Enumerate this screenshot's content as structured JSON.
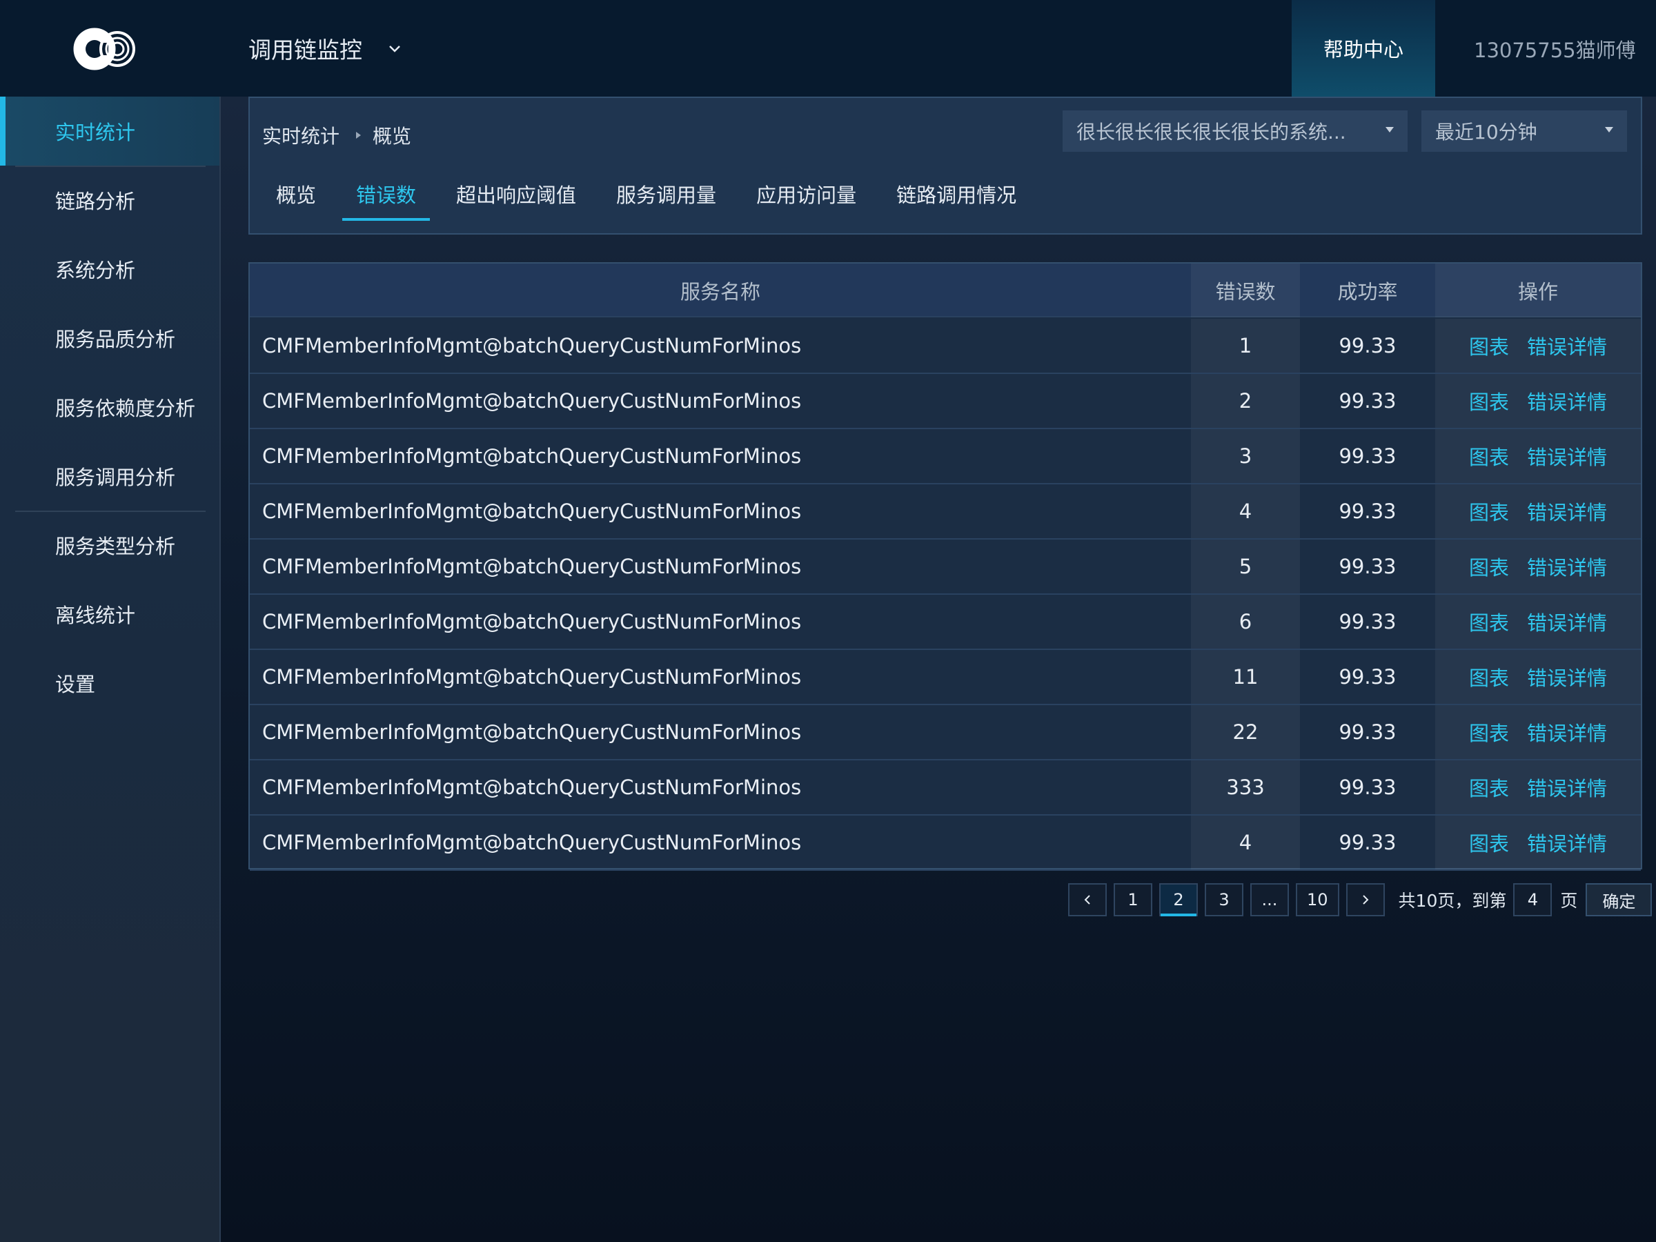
{
  "header": {
    "logo_icon": "swirl-logo-icon",
    "app_title": "调用链监控",
    "help": "帮助中心",
    "user": "13075755猫师傅"
  },
  "sidebar": {
    "items": [
      {
        "label": "实时统计",
        "active": true
      },
      {
        "label": "链路分析"
      },
      {
        "label": "系统分析"
      },
      {
        "label": "服务品质分析"
      },
      {
        "label": "服务依赖度分析"
      },
      {
        "label": "服务调用分析"
      },
      {
        "label": "服务类型分析"
      },
      {
        "label": "离线统计"
      },
      {
        "label": "设置"
      }
    ]
  },
  "breadcrumb": {
    "root": "实时统计",
    "current": "概览"
  },
  "filters": {
    "system": "很长很长很长很长很长的系统...",
    "time_range": "最近10分钟"
  },
  "tabs": [
    {
      "label": "概览"
    },
    {
      "label": "错误数",
      "active": true
    },
    {
      "label": "超出响应阈值"
    },
    {
      "label": "服务调用量"
    },
    {
      "label": "应用访问量"
    },
    {
      "label": "链路调用情况"
    }
  ],
  "table": {
    "columns": [
      "服务名称",
      "错误数",
      "成功率",
      "操作"
    ],
    "actions": [
      "图表",
      "错误详情"
    ],
    "rows": [
      {
        "name": "CMFMemberInfoMgmt@batchQueryCustNumForMinos",
        "errors": "1",
        "rate": "99.33"
      },
      {
        "name": "CMFMemberInfoMgmt@batchQueryCustNumForMinos",
        "errors": "2",
        "rate": "99.33"
      },
      {
        "name": "CMFMemberInfoMgmt@batchQueryCustNumForMinos",
        "errors": "3",
        "rate": "99.33"
      },
      {
        "name": "CMFMemberInfoMgmt@batchQueryCustNumForMinos",
        "errors": "4",
        "rate": "99.33"
      },
      {
        "name": "CMFMemberInfoMgmt@batchQueryCustNumForMinos",
        "errors": "5",
        "rate": "99.33"
      },
      {
        "name": "CMFMemberInfoMgmt@batchQueryCustNumForMinos",
        "errors": "6",
        "rate": "99.33"
      },
      {
        "name": "CMFMemberInfoMgmt@batchQueryCustNumForMinos",
        "errors": "11",
        "rate": "99.33"
      },
      {
        "name": "CMFMemberInfoMgmt@batchQueryCustNumForMinos",
        "errors": "22",
        "rate": "99.33"
      },
      {
        "name": "CMFMemberInfoMgmt@batchQueryCustNumForMinos",
        "errors": "333",
        "rate": "99.33"
      },
      {
        "name": "CMFMemberInfoMgmt@batchQueryCustNumForMinos",
        "errors": "4",
        "rate": "99.33"
      }
    ]
  },
  "pagination": {
    "pages": [
      "1",
      "2",
      "3",
      "...",
      "10"
    ],
    "active_page": "2",
    "total_text": "共10页，到第",
    "goto_value": "4",
    "page_suffix": "页",
    "confirm": "确定"
  },
  "colors": {
    "accent": "#2ec7ee",
    "topbar": "#071a2e",
    "panel": "#1f3550"
  }
}
